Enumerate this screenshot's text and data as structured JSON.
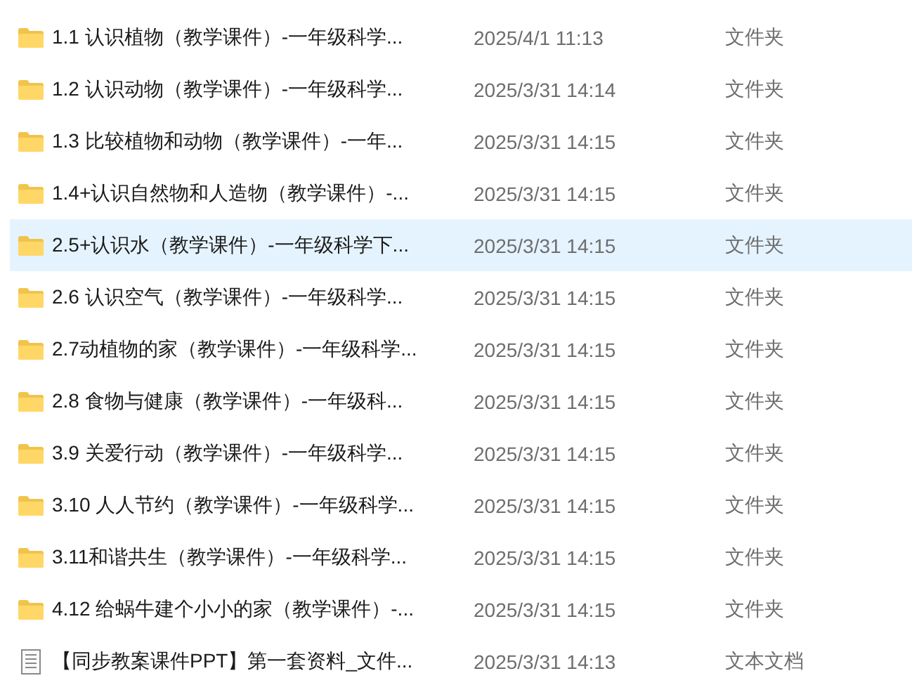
{
  "file_list": {
    "rows": [
      {
        "kind": "folder",
        "name": "1.1 认识植物（教学课件）-一年级科学...",
        "modified": "2025/4/1 11:13",
        "type": "文件夹",
        "selected": false
      },
      {
        "kind": "folder",
        "name": "1.2 认识动物（教学课件）-一年级科学...",
        "modified": "2025/3/31 14:14",
        "type": "文件夹",
        "selected": false
      },
      {
        "kind": "folder",
        "name": "1.3 比较植物和动物（教学课件）-一年...",
        "modified": "2025/3/31 14:15",
        "type": "文件夹",
        "selected": false
      },
      {
        "kind": "folder",
        "name": "1.4+认识自然物和人造物（教学课件）-...",
        "modified": "2025/3/31 14:15",
        "type": "文件夹",
        "selected": false
      },
      {
        "kind": "folder",
        "name": "2.5+认识水（教学课件）-一年级科学下...",
        "modified": "2025/3/31 14:15",
        "type": "文件夹",
        "selected": true
      },
      {
        "kind": "folder",
        "name": "2.6 认识空气（教学课件）-一年级科学...",
        "modified": "2025/3/31 14:15",
        "type": "文件夹",
        "selected": false
      },
      {
        "kind": "folder",
        "name": "2.7动植物的家（教学课件）-一年级科学...",
        "modified": "2025/3/31 14:15",
        "type": "文件夹",
        "selected": false
      },
      {
        "kind": "folder",
        "name": "2.8 食物与健康（教学课件）-一年级科...",
        "modified": "2025/3/31 14:15",
        "type": "文件夹",
        "selected": false
      },
      {
        "kind": "folder",
        "name": "3.9 关爱行动（教学课件）-一年级科学...",
        "modified": "2025/3/31 14:15",
        "type": "文件夹",
        "selected": false
      },
      {
        "kind": "folder",
        "name": "3.10 人人节约（教学课件）-一年级科学...",
        "modified": "2025/3/31 14:15",
        "type": "文件夹",
        "selected": false
      },
      {
        "kind": "folder",
        "name": "3.11和谐共生（教学课件）-一年级科学...",
        "modified": "2025/3/31 14:15",
        "type": "文件夹",
        "selected": false
      },
      {
        "kind": "folder",
        "name": "4.12 给蜗牛建个小小的家（教学课件）-...",
        "modified": "2025/3/31 14:15",
        "type": "文件夹",
        "selected": false
      },
      {
        "kind": "document",
        "name": "【同步教案课件PPT】第一套资料_文件...",
        "modified": "2025/3/31 14:13",
        "type": "文本文档",
        "selected": false
      }
    ]
  }
}
